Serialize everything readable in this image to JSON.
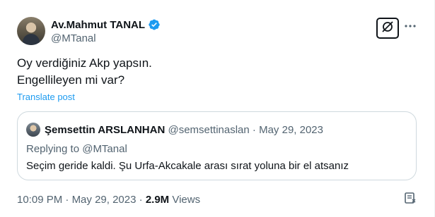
{
  "author": {
    "display_name": "Av.Mahmut TANAL",
    "handle": "@MTanal",
    "verified": true,
    "verified_color": "#1d9bf0"
  },
  "tweet": {
    "lines": [
      "Oy verdiğiniz Akp yapsın.",
      "Engellileyen mi var?"
    ],
    "translate_label": "Translate post"
  },
  "quoted": {
    "display_name": "Şemsettin ARSLANHAN",
    "handle": "@semsettinaslan",
    "separator": " · ",
    "date": "May 29, 2023",
    "replying_to": "Replying to @MTanal",
    "text": "Seçim geride kaldi. Şu Urfa-Akcakale arası sırat yoluna bir el atsanız"
  },
  "footer": {
    "time": "10:09 PM",
    "separator": " · ",
    "date": "May 29, 2023",
    "views_count": "2.9M",
    "views_label": "Views"
  },
  "icons": {
    "grok": "grok-icon",
    "more": "more-options-icon",
    "verified": "verified-badge-icon",
    "bookmark": "bookmark-icon"
  },
  "colors": {
    "text": "#0f1419",
    "secondary": "#536471",
    "link": "#1d9bf0",
    "border": "#cfd9de"
  }
}
